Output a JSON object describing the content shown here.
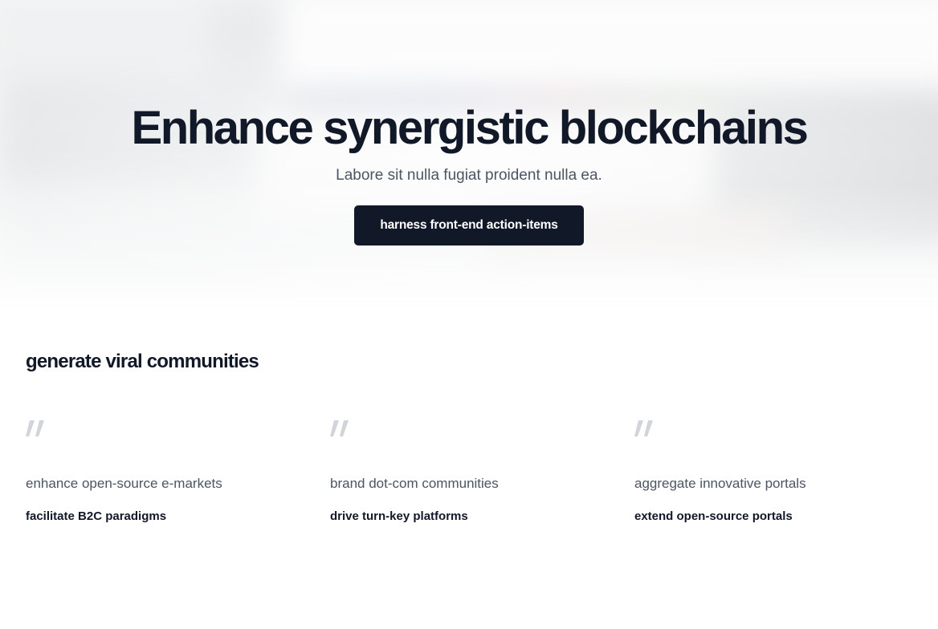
{
  "hero": {
    "title": "Enhance synergistic blockchains",
    "subtitle": "Labore sit nulla fugiat proident nulla ea.",
    "cta_label": "harness front-end action-items"
  },
  "section": {
    "title": "generate viral communities",
    "testimonials": [
      {
        "quote": "enhance open-source e-markets",
        "author": "facilitate B2C paradigms"
      },
      {
        "quote": "brand dot-com communities",
        "author": "drive turn-key platforms"
      },
      {
        "quote": "aggregate innovative portals",
        "author": "extend open-source portals"
      }
    ]
  },
  "icons": {
    "quote": "quote-icon"
  },
  "colors": {
    "primary": "#111827",
    "text_muted": "#4b5563",
    "quote_icon": "#d1d5db",
    "background": "#ffffff"
  }
}
